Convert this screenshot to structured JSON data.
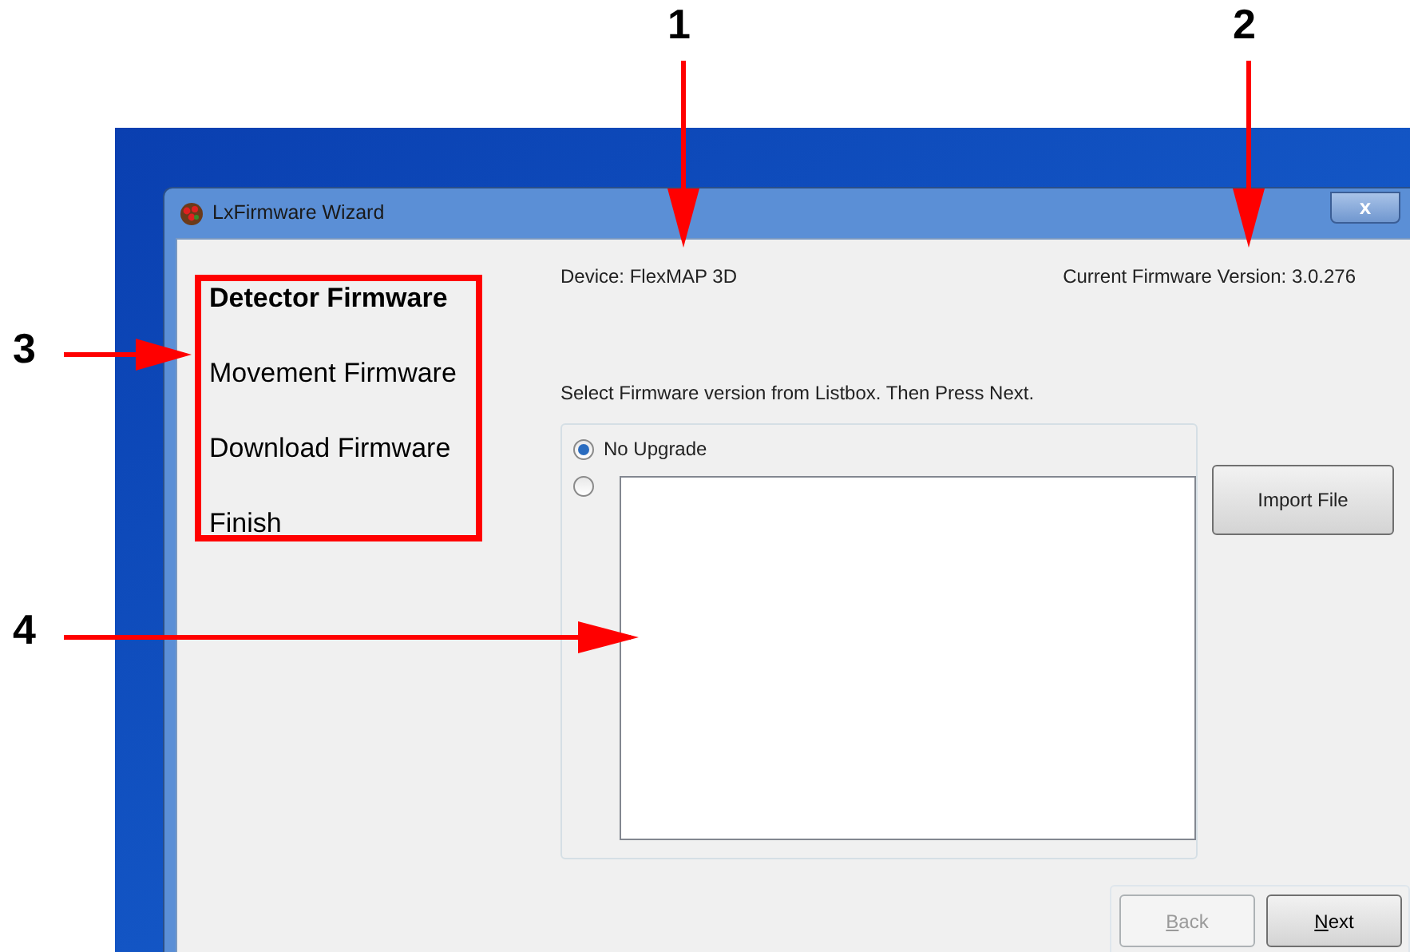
{
  "window": {
    "title": "LxFirmware Wizard",
    "close": "x"
  },
  "steps": [
    {
      "label": "Detector Firmware",
      "selected": true
    },
    {
      "label": "Movement Firmware",
      "selected": false
    },
    {
      "label": "Download Firmware",
      "selected": false
    },
    {
      "label": "Finish",
      "selected": false
    }
  ],
  "device": "Device: FlexMAP 3D",
  "current_version": "Current Firmware Version: 3.0.276",
  "instruction": "Select Firmware version from Listbox. Then Press Next.",
  "options": [
    {
      "kind": "radio",
      "label": "No Upgrade",
      "selected": true
    },
    {
      "kind": "listbox",
      "selected": false
    }
  ],
  "import_button": "Import File",
  "buttons": [
    {
      "label": "Back",
      "disabled": true
    },
    {
      "label": "Next",
      "disabled": false
    }
  ],
  "callouts": [
    {
      "label": "1"
    },
    {
      "label": "2"
    },
    {
      "label": "3"
    },
    {
      "label": "4"
    }
  ]
}
